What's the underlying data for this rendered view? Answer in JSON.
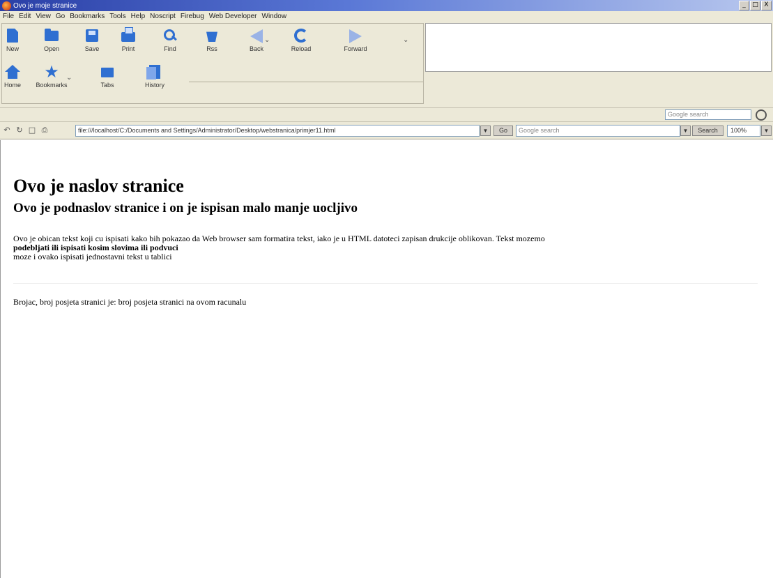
{
  "window": {
    "title": "Ovo je moje stranice",
    "controls": [
      "_",
      "□",
      "X"
    ]
  },
  "menu": [
    "File",
    "Edit",
    "View",
    "Go",
    "Bookmarks",
    "Tools",
    "Help",
    "Noscript",
    "Firebug",
    "Web Developer",
    "Window"
  ],
  "toolbar": {
    "new": "New",
    "open": "Open",
    "save": "Save",
    "print": "Print",
    "find": "Find",
    "rss": "Rss",
    "back": "Back",
    "reload": "Reload",
    "forward": "Forward",
    "home": "Home",
    "bookmarks": "Bookmarks",
    "tabs": "Tabs",
    "history": "History"
  },
  "google_search": {
    "placeholder": "Google search"
  },
  "address_bar": {
    "url": "file:///localhost/C:/Documents and Settings/Administrator/Desktop/webstranica/primjer11.html",
    "go_label": "Go",
    "search_placeholder": "Google search",
    "search_button": "Search",
    "zoom": "100%"
  },
  "page": {
    "heading1": "Ovo je naslov stranice",
    "heading2": "Ovo je podnaslov stranice i on je ispisan malo manje uocljivo",
    "paragraph_line1": "Ovo je obican tekst koji cu ispisati kako bih pokazao da Web browser sam formatira tekst, iako je u HTML datoteci zapisan drukcije oblikovan. Tekst mozemo",
    "paragraph_line2": "podebljati ili ispisati kosim slovima ili podvuci",
    "paragraph_line3": "moze i ovako ispisati jednostavni tekst u tablici",
    "counter_text": "Brojac, broj posjeta stranici je: broj posjeta stranici na ovom racunalu"
  }
}
